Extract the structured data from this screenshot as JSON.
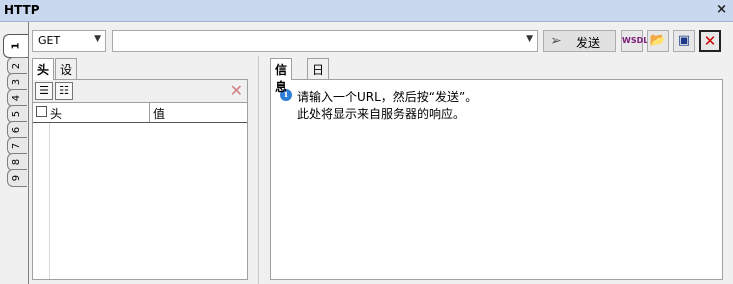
{
  "window": {
    "title": "HTTP",
    "close_glyph": "×"
  },
  "side_tabs": [
    "1",
    "2",
    "3",
    "4",
    "5",
    "6",
    "7",
    "8",
    "9"
  ],
  "toolbar": {
    "method": "GET",
    "url_value": "",
    "send_label": "发送",
    "wsdl_label": "WSDL",
    "icons": [
      "wsdl-icon",
      "open-folder-icon",
      "save-icon",
      "close-icon"
    ]
  },
  "left_panel": {
    "tabs": [
      {
        "label": "头"
      },
      {
        "label": "设置"
      }
    ],
    "columns": {
      "name": "头",
      "value": "值"
    }
  },
  "right_panel": {
    "tabs": [
      {
        "label": "信息"
      },
      {
        "label": "日志"
      }
    ],
    "message_line1": "请输入一个URL，然后按“发送”。",
    "message_line2": "此处将显示来自服务器的响应。"
  }
}
